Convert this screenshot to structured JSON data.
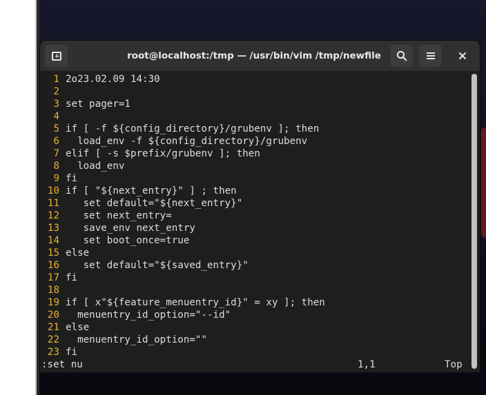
{
  "window": {
    "title": "root@localhost:/tmp — /usr/bin/vim /tmp/newfile",
    "buttons": {
      "new_tab_icon": "new-tab-icon",
      "search_icon": "search-icon",
      "menu_icon": "menu-icon",
      "close_icon": "close-icon",
      "close_glyph": "✕"
    }
  },
  "editor": {
    "lines": [
      {
        "num": "1",
        "text": "2o23.02.09 14:30"
      },
      {
        "num": "2",
        "text": ""
      },
      {
        "num": "3",
        "text": "set pager=1"
      },
      {
        "num": "4",
        "text": ""
      },
      {
        "num": "5",
        "text": "if [ -f ${config_directory}/grubenv ]; then"
      },
      {
        "num": "6",
        "text": "  load_env -f ${config_directory}/grubenv"
      },
      {
        "num": "7",
        "text": "elif [ -s $prefix/grubenv ]; then"
      },
      {
        "num": "8",
        "text": "  load_env"
      },
      {
        "num": "9",
        "text": "fi"
      },
      {
        "num": "10",
        "text": "if [ \"${next_entry}\" ] ; then"
      },
      {
        "num": "11",
        "text": "   set default=\"${next_entry}\""
      },
      {
        "num": "12",
        "text": "   set next_entry="
      },
      {
        "num": "13",
        "text": "   save_env next_entry"
      },
      {
        "num": "14",
        "text": "   set boot_once=true"
      },
      {
        "num": "15",
        "text": "else"
      },
      {
        "num": "16",
        "text": "   set default=\"${saved_entry}\""
      },
      {
        "num": "17",
        "text": "fi"
      },
      {
        "num": "18",
        "text": ""
      },
      {
        "num": "19",
        "text": "if [ x\"${feature_menuentry_id}\" = xy ]; then"
      },
      {
        "num": "20",
        "text": "  menuentry_id_option=\"--id\""
      },
      {
        "num": "21",
        "text": "else"
      },
      {
        "num": "22",
        "text": "  menuentry_id_option=\"\""
      },
      {
        "num": "23",
        "text": "fi"
      }
    ],
    "command_line": ":set nu",
    "cursor_position": "1,1",
    "scroll_position": "Top"
  },
  "colors": {
    "line_number": "#e8b230",
    "text": "#dedede",
    "background": "#1e1e1e",
    "headerbar": "#303030"
  }
}
